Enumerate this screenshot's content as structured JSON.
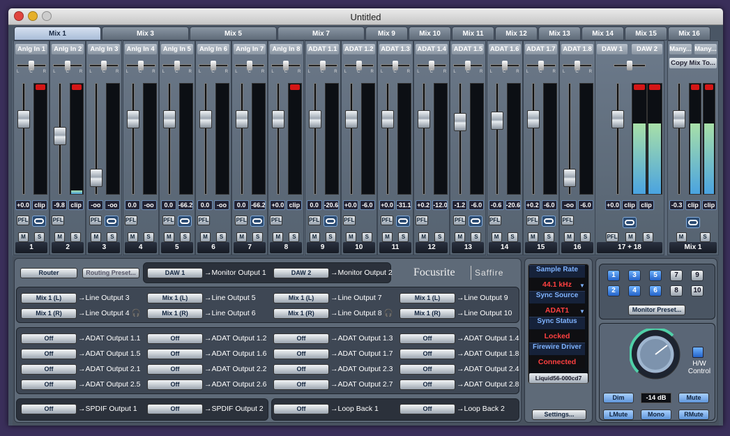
{
  "window": {
    "title": "Untitled"
  },
  "tabs": [
    "Mix 1",
    "Mix 3",
    "Mix 5",
    "Mix 7",
    "Mix 9",
    "Mix 10",
    "Mix 11",
    "Mix 12",
    "Mix 13",
    "Mix 14",
    "Mix 15",
    "Mix 16"
  ],
  "channels": [
    {
      "name": "Anlg In 1",
      "num": "1",
      "val": "+0.0",
      "peak": "clip",
      "fader": 0.72,
      "level": 0,
      "clip": true
    },
    {
      "name": "Anlg In 2",
      "num": "2",
      "val": "-9.8",
      "peak": "clip",
      "fader": 0.55,
      "level": 0.03,
      "clip": true
    },
    {
      "name": "Anlg In 3",
      "num": "3",
      "val": "-oo",
      "peak": "-oo",
      "fader": 0.12,
      "level": 0,
      "clip": false
    },
    {
      "name": "Anlg In 4",
      "num": "4",
      "val": "0.0",
      "peak": "-oo",
      "fader": 0.72,
      "level": 0,
      "clip": false
    },
    {
      "name": "Anlg In 5",
      "num": "5",
      "val": "0.0",
      "peak": "-66.2",
      "fader": 0.72,
      "level": 0,
      "clip": false
    },
    {
      "name": "Anlg In 6",
      "num": "6",
      "val": "0.0",
      "peak": "-oo",
      "fader": 0.72,
      "level": 0,
      "clip": false
    },
    {
      "name": "Anlg In 7",
      "num": "7",
      "val": "0.0",
      "peak": "-66.2",
      "fader": 0.72,
      "level": 0,
      "clip": false
    },
    {
      "name": "Anlg In 8",
      "num": "8",
      "val": "+0.0",
      "peak": "clip",
      "fader": 0.72,
      "level": 0,
      "clip": true
    },
    {
      "name": "ADAT 1.1",
      "num": "9",
      "val": "0.0",
      "peak": "-20.6",
      "fader": 0.72,
      "level": 0,
      "clip": false
    },
    {
      "name": "ADAT 1.2",
      "num": "10",
      "val": "+0.0",
      "peak": "-6.0",
      "fader": 0.72,
      "level": 0,
      "clip": false
    },
    {
      "name": "ADAT 1.3",
      "num": "11",
      "val": "+0.0",
      "peak": "-31.1",
      "fader": 0.72,
      "level": 0,
      "clip": false
    },
    {
      "name": "ADAT 1.4",
      "num": "12",
      "val": "+0.2",
      "peak": "-12.0",
      "fader": 0.72,
      "level": 0,
      "clip": false
    },
    {
      "name": "ADAT 1.5",
      "num": "13",
      "val": "-1.2",
      "peak": "-6.0",
      "fader": 0.69,
      "level": 0,
      "clip": false
    },
    {
      "name": "ADAT 1.6",
      "num": "14",
      "val": "-0.6",
      "peak": "-20.6",
      "fader": 0.71,
      "level": 0,
      "clip": false
    },
    {
      "name": "ADAT 1.7",
      "num": "15",
      "val": "+0.2",
      "peak": "-6.0",
      "fader": 0.72,
      "level": 0,
      "clip": false
    },
    {
      "name": "ADAT 1.8",
      "num": "16",
      "val": "-oo",
      "peak": "-6.0",
      "fader": 0.12,
      "level": 0,
      "clip": false
    }
  ],
  "daw": {
    "names": [
      "DAW 1",
      "DAW 2"
    ],
    "num": "17 + 18",
    "vals": [
      "+0.0",
      "clip",
      "clip"
    ],
    "level": 0.64
  },
  "many": {
    "names": [
      "Many...",
      "Many..."
    ],
    "copy": "Copy Mix To...",
    "num": "Mix 1",
    "vals": [
      "-0.3",
      "clip",
      "clip"
    ],
    "level": 0.64
  },
  "buttons": {
    "pfl": "PFL",
    "m": "M",
    "s": "S"
  },
  "routing": {
    "router": "Router",
    "preset": "Routing Preset...",
    "brand": "Focusrite",
    "product": "Saffire",
    "monitor": [
      {
        "src": "DAW 1",
        "dst": "Monitor Output 1"
      },
      {
        "src": "DAW 2",
        "dst": "Monitor Output 2"
      }
    ],
    "line": [
      {
        "src": "Mix 1 (L)",
        "dst": "Line Output 3"
      },
      {
        "src": "Mix 1 (R)",
        "dst": "Line Output 4"
      },
      {
        "src": "Mix 1 (L)",
        "dst": "Line Output 5"
      },
      {
        "src": "Mix 1 (R)",
        "dst": "Line Output 6"
      },
      {
        "src": "Mix 1 (L)",
        "dst": "Line Output 7"
      },
      {
        "src": "Mix 1 (R)",
        "dst": "Line Output 8"
      },
      {
        "src": "Mix 1 (L)",
        "dst": "Line Output 9"
      },
      {
        "src": "Mix 1 (R)",
        "dst": "Line Output 10"
      }
    ],
    "adat": [
      {
        "src": "Off",
        "dst": "ADAT Output 1.1"
      },
      {
        "src": "Off",
        "dst": "ADAT Output 1.2"
      },
      {
        "src": "Off",
        "dst": "ADAT Output 1.3"
      },
      {
        "src": "Off",
        "dst": "ADAT Output 1.4"
      },
      {
        "src": "Off",
        "dst": "ADAT Output 1.5"
      },
      {
        "src": "Off",
        "dst": "ADAT Output 1.6"
      },
      {
        "src": "Off",
        "dst": "ADAT Output 1.7"
      },
      {
        "src": "Off",
        "dst": "ADAT Output 1.8"
      },
      {
        "src": "Off",
        "dst": "ADAT Output 2.1"
      },
      {
        "src": "Off",
        "dst": "ADAT Output 2.2"
      },
      {
        "src": "Off",
        "dst": "ADAT Output 2.3"
      },
      {
        "src": "Off",
        "dst": "ADAT Output 2.4"
      },
      {
        "src": "Off",
        "dst": "ADAT Output 2.5"
      },
      {
        "src": "Off",
        "dst": "ADAT Output 2.6"
      },
      {
        "src": "Off",
        "dst": "ADAT Output 2.7"
      },
      {
        "src": "Off",
        "dst": "ADAT Output 2.8"
      }
    ],
    "spdif": [
      {
        "src": "Off",
        "dst": "SPDIF Output 1"
      },
      {
        "src": "Off",
        "dst": "SPDIF Output 2"
      }
    ],
    "loop": [
      {
        "src": "Off",
        "dst": "Loop Back 1"
      },
      {
        "src": "Off",
        "dst": "Loop Back 2"
      }
    ]
  },
  "status": {
    "sample_rate_label": "Sample Rate",
    "sample_rate": "44.1 kHz",
    "sync_source_label": "Sync Source",
    "sync_source": "ADAT1",
    "sync_status_label": "Sync Status",
    "sync_status": "Locked",
    "firewire_label": "Firewire Driver",
    "firewire": "Connected",
    "device": "Liquid56-000cd7",
    "settings": "Settings..."
  },
  "monitor": {
    "numbers": [
      "1",
      "3",
      "5",
      "7",
      "9",
      "2",
      "4",
      "6",
      "8",
      "10"
    ],
    "on": [
      true,
      true,
      true,
      false,
      false,
      true,
      true,
      true,
      false,
      false
    ],
    "preset": "Monitor Preset...",
    "volume": "-14 dB",
    "hw_control": "H/W Control",
    "dim": "Dim",
    "mute": "Mute",
    "lmute": "LMute",
    "mono": "Mono",
    "rmute": "RMute"
  },
  "colors": {
    "accent": "#2463c9",
    "clip": "#d41616",
    "status_value": "#ff4040"
  }
}
